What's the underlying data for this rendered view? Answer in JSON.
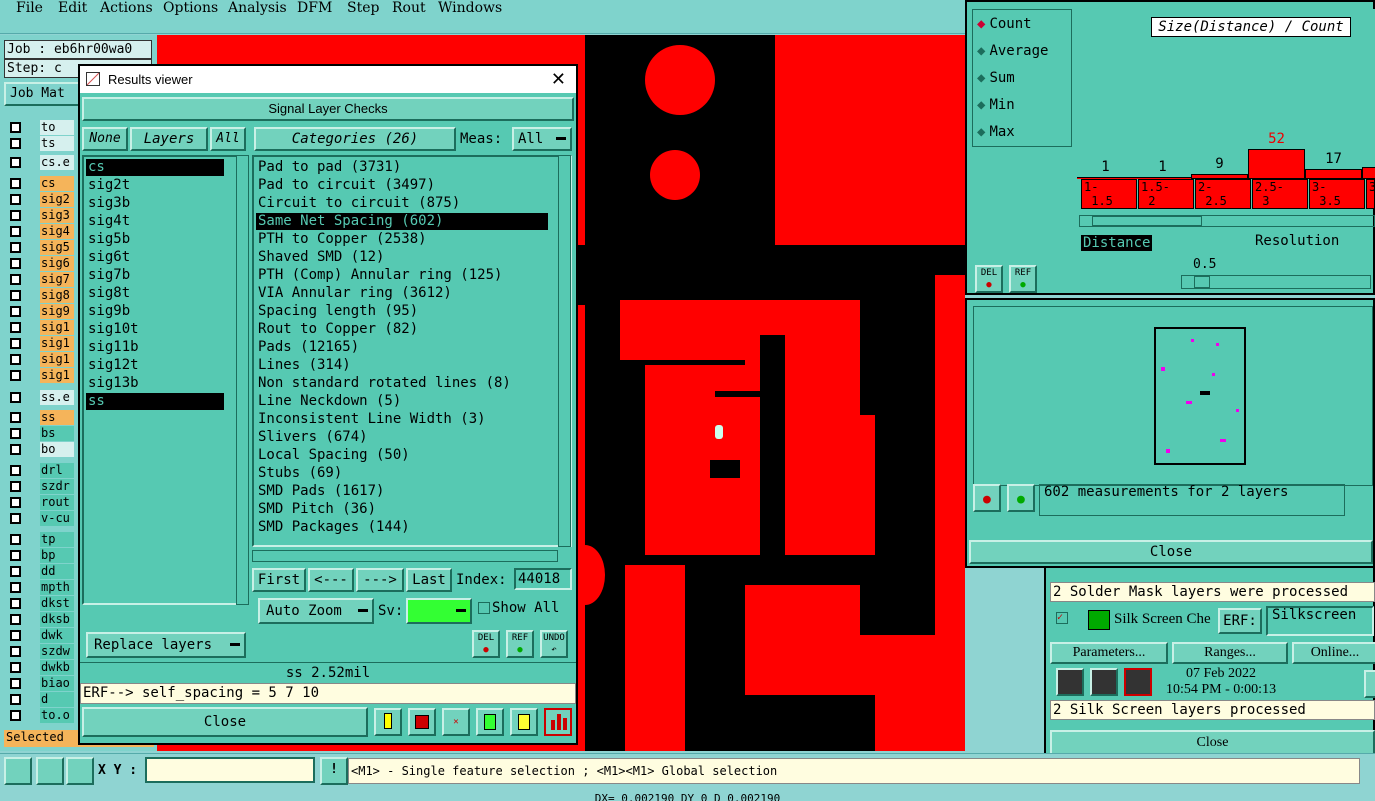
{
  "menu": {
    "items": [
      "File",
      "Edit",
      "Actions",
      "Options",
      "Analysis",
      "DFM",
      "Step",
      "Rout",
      "Windows"
    ]
  },
  "job": {
    "job_label": "Job : eb6hr00wa0",
    "step_label": "Step: c",
    "matrix_btn": "Job Mat"
  },
  "left_layers": {
    "top_boxes": [
      "to",
      "ts"
    ],
    "group1_header": "cs.e",
    "group1": [
      "cs",
      "sig2",
      "sig3",
      "sig4",
      "sig5",
      "sig6",
      "sig7",
      "sig8",
      "sig9",
      "sig1",
      "sig1",
      "sig1",
      "sig1"
    ],
    "group2_header": "ss.e",
    "group2": [
      "ss",
      "bs",
      "bo"
    ],
    "group3": [
      "drl",
      "szdr",
      "rout",
      "v-cu"
    ],
    "group4": [
      "tp",
      "bp",
      "dd",
      "mpth",
      "dkst",
      "dksb",
      "dwk",
      "szdw",
      "dwkb",
      "biao",
      "d",
      "to.o"
    ],
    "selected_label": "Selected"
  },
  "results_viewer": {
    "title": "Results viewer",
    "header": "Signal Layer Checks",
    "none_btn": "None",
    "layers_btn": "Layers",
    "all_btn": "All",
    "categories_btn": "Categories (26)",
    "meas_label": "Meas:",
    "meas_value": "All",
    "layers": [
      "cs",
      "sig2t",
      "sig3b",
      "sig4t",
      "sig5b",
      "sig6t",
      "sig7b",
      "sig8t",
      "sig9b",
      "sig10t",
      "sig11b",
      "sig12t",
      "sig13b",
      "ss"
    ],
    "categories": [
      "Pad to pad (3731)",
      "Pad to circuit (3497)",
      "Circuit to circuit (875)",
      "Same Net Spacing (602)",
      "PTH to Copper (2538)",
      "Shaved SMD (12)",
      "PTH (Comp) Annular ring (125)",
      "VIA Annular ring (3612)",
      "Spacing length (95)",
      "Rout to Copper (82)",
      "Pads (12165)",
      "Lines (314)",
      "Non standard rotated lines (8)",
      "Line Neckdown (5)",
      "Inconsistent Line Width (3)",
      "Slivers (674)",
      "Local Spacing (50)",
      "Stubs (69)",
      "SMD Pads (1617)",
      "SMD Pitch (36)",
      "SMD Packages (144)"
    ],
    "first_btn": "First",
    "prev_btn": "<---",
    "next_btn": "--->",
    "last_btn": "Last",
    "index_label": "Index:",
    "index_value": "44018",
    "auto_zoom": "Auto Zoom",
    "sv_label": "Sv:",
    "show_all": "Show All",
    "replace_layers": "Replace layers",
    "del": "DEL",
    "ref": "REF",
    "undo": "UNDO",
    "measure": "ss 2.52mil",
    "erf_line": "ERF--> self_spacing = 5 7 10",
    "close": "Close"
  },
  "histogram": {
    "options": [
      "Count",
      "Average",
      "Sum",
      "Min",
      "Max"
    ],
    "title": "Size(Distance) / Count",
    "bars": [
      {
        "label": "1",
        "range": "1-\n 1.5",
        "value": 1
      },
      {
        "label": "1",
        "range": "1.5-\n 2",
        "value": 1
      },
      {
        "label": "9",
        "range": "2-\n 2.5",
        "value": 9
      },
      {
        "label": "52",
        "range": "2.5-\n 3",
        "value": 52
      },
      {
        "label": "17",
        "range": "3-\n 3.5",
        "value": 17
      },
      {
        "label": "",
        "range": "3",
        "value": 20
      }
    ],
    "distance_label": "Distance",
    "resolution_label": "Resolution",
    "resolution_value": "0.5",
    "del": "DEL",
    "ref": "REF",
    "summary": "602 measurements for 2 layers",
    "close": "Close"
  },
  "checklist": {
    "solder_msg": "2 Solder Mask layers were processed",
    "silk_label": "Silk Screen Che",
    "erf_label": "ERF:",
    "erf_value": "Silkscreen",
    "params_btn": "Parameters...",
    "ranges_btn": "Ranges...",
    "online_btn": "Online...",
    "date": "07 Feb 2022",
    "time": "10:54 PM - 0:00:13",
    "silk_msg": "2 Silk Screen layers processed",
    "close": "Close"
  },
  "status": {
    "xy_label": "X Y :",
    "xy_value": "",
    "message": "<M1> - Single feature selection ; <M1><M1> Global selection",
    "bottom": "DX= 0.002190 DY 0 D 0.002190"
  },
  "colors": {
    "canvas": "#ff0000",
    "panel": "#56c9b2",
    "sv": "#33ff33"
  }
}
